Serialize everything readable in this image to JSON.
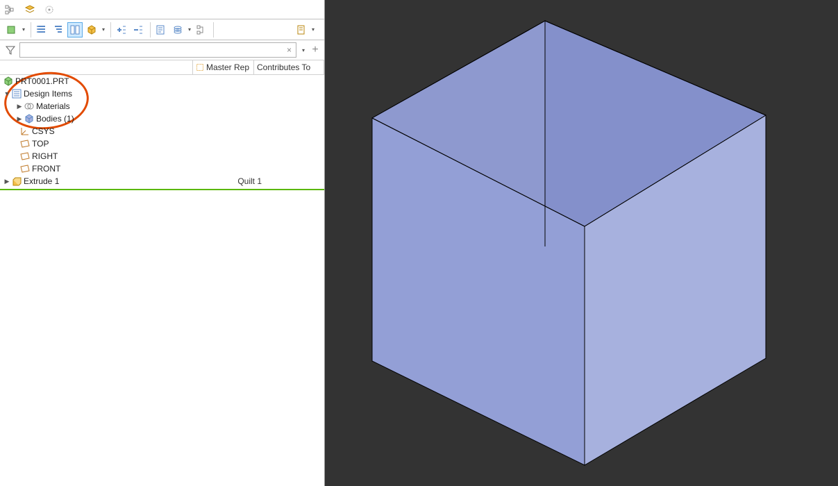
{
  "columns": {
    "master": "Master Rep",
    "contrib": "Contributes To"
  },
  "search": {
    "placeholder": "",
    "clear": "×",
    "plus": "+"
  },
  "tree": {
    "root": "PRT0001.PRT",
    "design_items": "Design Items",
    "materials": "Materials",
    "bodies": "Bodies (1)",
    "csys": "CSYS",
    "top": "TOP",
    "right": "RIGHT",
    "front": "FRONT",
    "extrude": "Extrude 1",
    "extrude_rep": "Quilt 1"
  },
  "viewport": {
    "bg": "#333333",
    "cube": {
      "fill_left": "#939FD6",
      "fill_right": "#A7B1DE",
      "fill_inside_left": "#8E99CF",
      "fill_inside_right": "#8490CB",
      "edge": "#000000"
    }
  }
}
